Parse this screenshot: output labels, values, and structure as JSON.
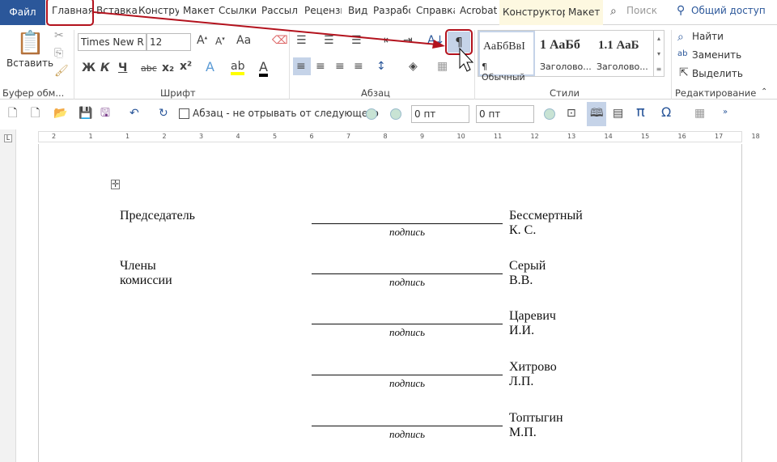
{
  "tabs": {
    "file": "Файл",
    "items": [
      "Главная",
      "Вставка",
      "Констру",
      "Макет",
      "Ссылки",
      "Рассыл",
      "Рецензи",
      "Вид",
      "Разрабо",
      "Справка",
      "Acrobat",
      "Конструктор",
      "Макет"
    ],
    "search": "Поиск",
    "share": "Общий доступ"
  },
  "clipboard": {
    "paste": "Вставить",
    "label": "Буфер обм..."
  },
  "font": {
    "name": "Times New R",
    "size": "12",
    "case": "Aa",
    "bold": "Ж",
    "italic": "К",
    "underline": "Ч",
    "strike": "abc",
    "sub": "x₂",
    "sup": "x²",
    "label": "Шрифт"
  },
  "paragraph": {
    "label": "Абзац",
    "pilcrow": "¶"
  },
  "styles": {
    "items": [
      {
        "preview": "АаБбВвІ",
        "name": "¶ Обычный"
      },
      {
        "preview": "1  АаБб",
        "name": "Заголово..."
      },
      {
        "preview": "1.1  АаБ",
        "name": "Заголово..."
      }
    ],
    "label": "Стили"
  },
  "editing": {
    "find": "Найти",
    "replace": "Заменить",
    "select": "Выделить",
    "label": "Редактирование"
  },
  "qat": {
    "keep_with_next": "Абзац - не отрывать от следующего",
    "spacing_before": "0 пт",
    "spacing_after": "0 пт"
  },
  "ruler": {
    "ticks": [
      "2",
      "1",
      "1",
      "2",
      "3",
      "4",
      "5",
      "6",
      "7",
      "8",
      "9",
      "10",
      "11",
      "12",
      "13",
      "14",
      "15",
      "16",
      "17",
      "18"
    ]
  },
  "document": {
    "roles": [
      "Председатель",
      "Члены комиссии"
    ],
    "signature_caption": "подпись",
    "names": [
      "Бессмертный К. С.",
      "Серый В.В.",
      "Царевич И.И.",
      "Хитрово Л.П.",
      "Топтыгин М.П."
    ]
  },
  "colors": {
    "accent": "#2b579a",
    "annotation": "#b3121d"
  }
}
